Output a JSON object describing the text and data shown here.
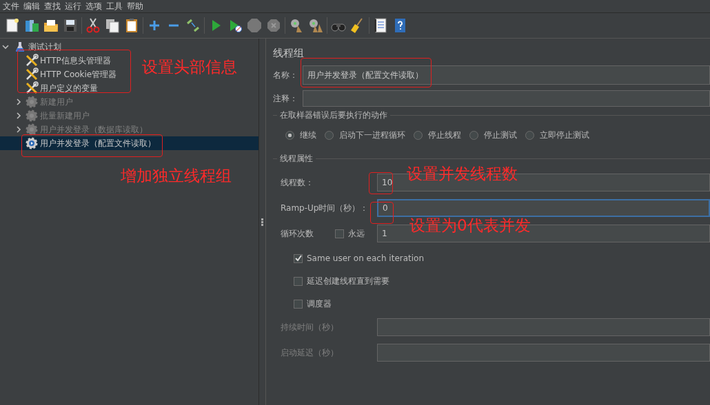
{
  "menu_bar": [
    "文件",
    "编辑",
    "查找",
    "运行",
    "选项",
    "工具",
    "帮助"
  ],
  "tree": {
    "label": "测试计划",
    "kind": "plan",
    "expanded": true,
    "children": [
      {
        "label": "HTTP信息头管理器",
        "kind": "config",
        "disabled": false,
        "selected": false
      },
      {
        "label": "HTTP Cookie管理器",
        "kind": "config",
        "disabled": false,
        "selected": false
      },
      {
        "label": "用户定义的变量",
        "kind": "config",
        "disabled": false,
        "selected": false
      },
      {
        "label": "新建用户",
        "kind": "thread_group",
        "disabled": true,
        "selected": false,
        "expanded": false
      },
      {
        "label": "批量新建用户",
        "kind": "thread_group",
        "disabled": true,
        "selected": false,
        "expanded": false
      },
      {
        "label": "用户并发登录（数据库读取）",
        "kind": "thread_group",
        "disabled": true,
        "selected": false,
        "expanded": false
      },
      {
        "label": "用户并发登录（配置文件读取）",
        "kind": "thread_group",
        "disabled": false,
        "selected": true
      }
    ]
  },
  "panel": {
    "title": "线程组",
    "name_field": {
      "label": "名称：",
      "value": "用户并发登录（配置文件读取）"
    },
    "comment_field": {
      "label": "注释："
    },
    "error_action": {
      "legend": "在取样器错误后要执行的动作",
      "options": [
        {
          "label": "继续",
          "selected": true
        },
        {
          "label": "启动下一进程循环",
          "selected": false
        },
        {
          "label": "停止线程",
          "selected": false
        },
        {
          "label": "停止测试",
          "selected": false
        },
        {
          "label": "立即停止测试",
          "selected": false
        }
      ]
    },
    "thread_properties": {
      "legend": "线程属性",
      "rows": [
        {
          "kind": "field",
          "label": "线程数：",
          "value": "10",
          "focused": false,
          "disabled": false
        },
        {
          "kind": "field",
          "label": "Ramp-Up时间（秒）：",
          "value": "0",
          "focused": true,
          "disabled": false
        },
        {
          "kind": "loop",
          "label": "循环次数",
          "checkbox_label": "永远",
          "checked": false,
          "value": "1"
        },
        {
          "kind": "checkbox",
          "label": "Same user on each iteration",
          "checked": true
        },
        {
          "kind": "checkbox",
          "label": "延迟创建线程直到需要",
          "checked": false
        },
        {
          "kind": "checkbox",
          "label": "调度器",
          "checked": false
        },
        {
          "kind": "field",
          "label": "持续时间（秒）",
          "focused": false,
          "disabled": true
        },
        {
          "kind": "field",
          "label": "启动延迟（秒）",
          "focused": false,
          "disabled": true
        }
      ]
    }
  },
  "annotations": [
    {
      "kind": "box"
    },
    {
      "kind": "text",
      "text": "设置头部信息"
    },
    {
      "kind": "box"
    },
    {
      "kind": "text",
      "text": "增加独立线程组"
    },
    {
      "kind": "box"
    },
    {
      "kind": "text",
      "text": "设置并发线程数"
    },
    {
      "kind": "box"
    },
    {
      "kind": "box"
    },
    {
      "kind": "text",
      "text": "设置为0代表并发"
    }
  ]
}
